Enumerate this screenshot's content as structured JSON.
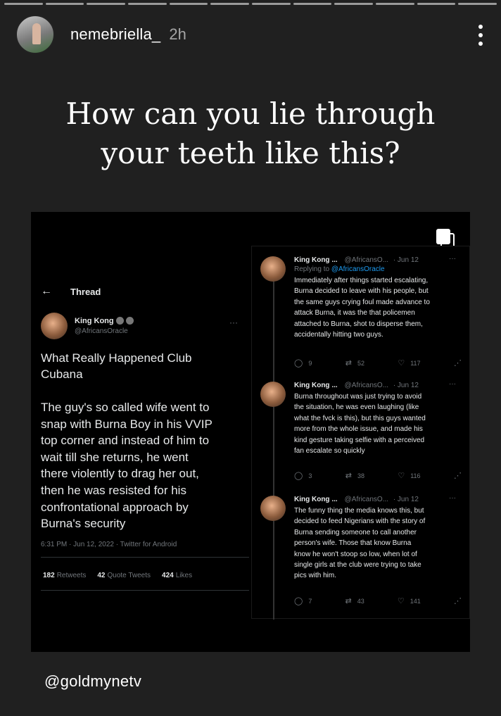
{
  "story": {
    "progress_segments": 12,
    "username": "nemebriella_",
    "time_ago": "2h",
    "caption_lines": [
      "How can you lie through",
      "your teeth like this?"
    ],
    "footer_mention": "@goldmynetv"
  },
  "left_tweet": {
    "thread_label": "Thread",
    "back_icon": "←",
    "author_name": "King Kong",
    "author_handle": "@AfricansOracle",
    "title_lines": [
      "What Really Happened Club",
      "Cubana"
    ],
    "body_lines": [
      "The guy's so called wife went to",
      "snap with Burna Boy in his VVIP",
      "top corner and instead of him to",
      "wait till she returns, he went",
      "there violently to drag her out,",
      "then he was resisted for his",
      "confrontational approach by",
      "Burna's security"
    ],
    "meta": "6:31 PM · Jun 12, 2022 · Twitter for Android",
    "stats": {
      "retweets_count": "182",
      "retweets_label": "Retweets",
      "quotes_count": "42",
      "quotes_label": "Quote Tweets",
      "likes_count": "424",
      "likes_label": "Likes"
    }
  },
  "replies": [
    {
      "name": "King Kong ...",
      "handle": "@AfricansO...",
      "date": "· Jun 12",
      "replying_prefix": "Replying to",
      "replying_to": "@AfricansOracle",
      "lines": [
        "Immediately after things started escalating,",
        "Burna decided to leave with his people, but",
        "the same guys crying foul made advance to",
        "attack Burna, it was the  that policemen",
        "attached to Burna, shot to disperse them,",
        "accidentally hitting two guys."
      ],
      "replies": "9",
      "retweets": "52",
      "likes": "117"
    },
    {
      "name": "King Kong ...",
      "handle": "@AfricansO...",
      "date": "· Jun 12",
      "lines": [
        "Burna throughout was just trying to avoid",
        "the situation, he was even laughing (like",
        "what the fvck is this), but this guys wanted",
        "more from the whole issue, and made his",
        "kind gesture taking selfie with a perceived",
        "fan escalate so quickly"
      ],
      "replies": "3",
      "retweets": "38",
      "likes": "116"
    },
    {
      "name": "King Kong ...",
      "handle": "@AfricansO...",
      "date": "· Jun 12",
      "lines": [
        "The funny thing the media knows this, but",
        "decided to feed Nigerians with the story of",
        "Burna sending someone to call another",
        "person's wife. Those that know Burna",
        "know he won't stoop so low, when lot of",
        "single girls at the club were trying to take",
        "pics with him."
      ],
      "replies": "7",
      "retweets": "43",
      "likes": "141"
    }
  ],
  "icons": {
    "more": "more-vertical-icon",
    "copy": "copy-icon",
    "reply": "reply-icon",
    "retweet": "retweet-icon",
    "like": "heart-icon",
    "share": "share-icon"
  }
}
